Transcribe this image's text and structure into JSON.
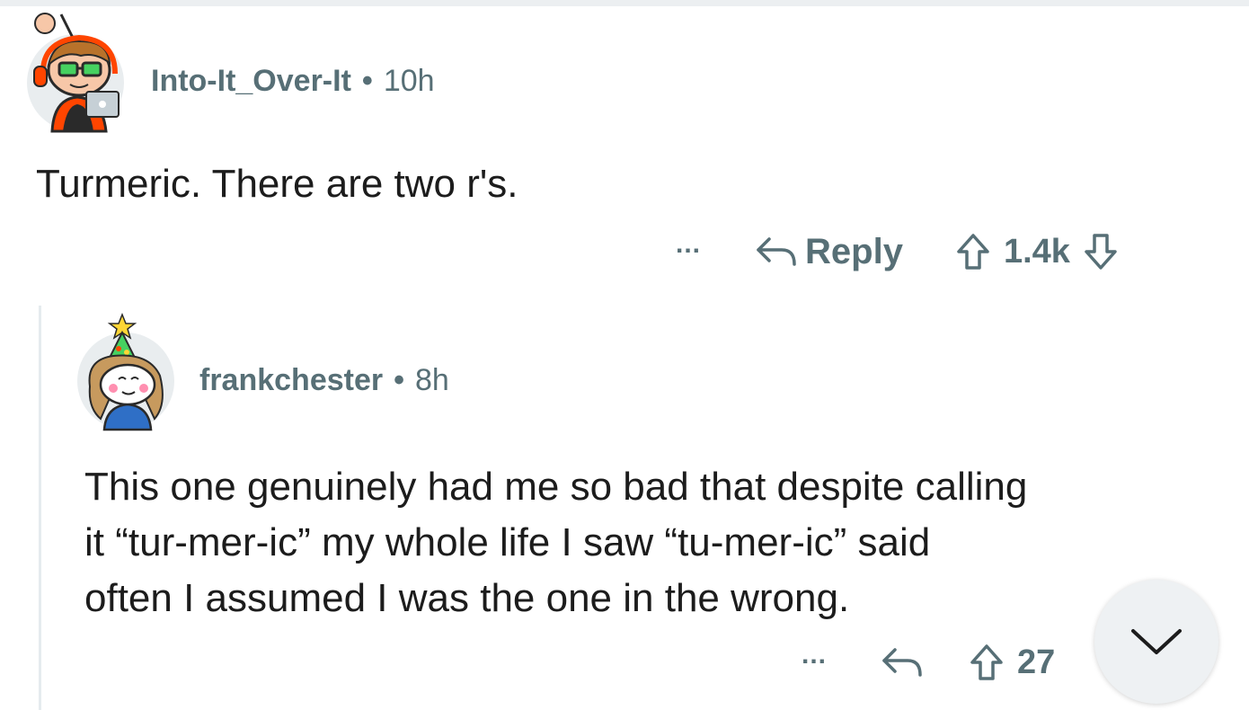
{
  "comments": [
    {
      "username": "Into-It_Over-It",
      "separator": "•",
      "time": "10h",
      "body": "Turmeric. There are two r's.",
      "actions": {
        "more_label": "...",
        "reply_label": "Reply",
        "vote_count": "1.4k"
      }
    },
    {
      "username": "frankchester",
      "separator": "•",
      "time": "8h",
      "body_lines": [
        "This one genuinely had me so bad that despite calling",
        "it “tur-mer-ic” my whole life I saw “tu-mer-ic” said",
        "often I assumed I was the one in the wrong."
      ],
      "actions": {
        "more_label": "...",
        "vote_count": "27"
      }
    }
  ],
  "icons": {
    "reply": "reply-arrow-icon",
    "upvote": "upvote-arrow-icon",
    "downvote": "downvote-arrow-icon",
    "collapse": "chevron-down-icon"
  },
  "colors": {
    "text": "#1c1c1c",
    "meta": "#576f76",
    "thread_line": "#e5ebee",
    "avatar_bg": "#e9edef"
  }
}
